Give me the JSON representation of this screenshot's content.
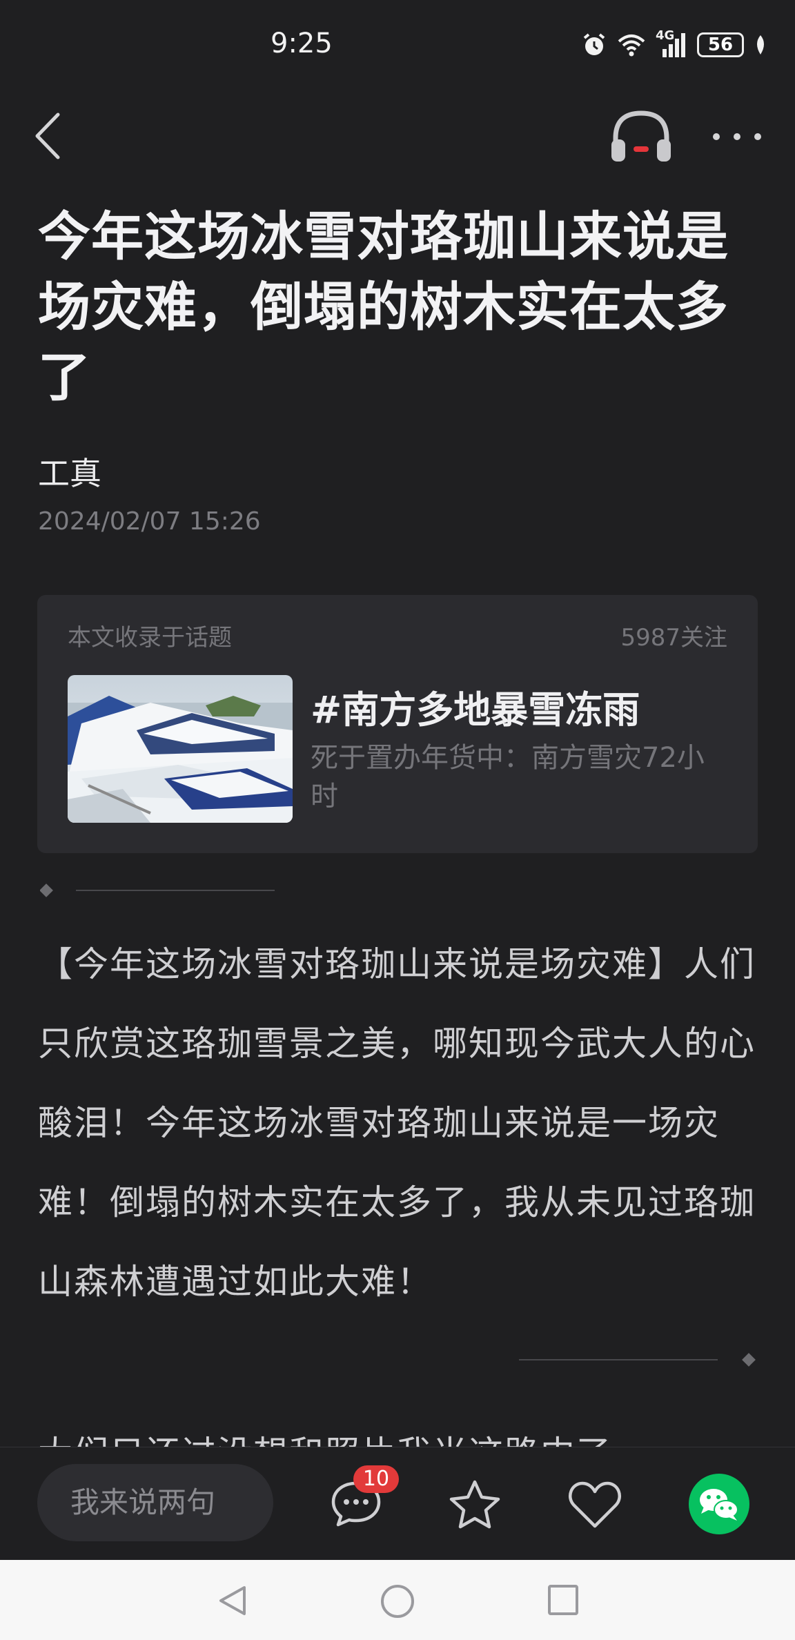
{
  "status_bar": {
    "time": "9:25",
    "network": "4G",
    "battery": "56",
    "icons": [
      "alarm-icon",
      "wifi-icon",
      "signal-icon",
      "battery-icon",
      "leaf-icon"
    ]
  },
  "header": {
    "icons": [
      "back-arrow-icon",
      "headphones-icon",
      "more-dots-icon"
    ]
  },
  "article": {
    "title": "今年这场冰雪对珞珈山来说是场灾难，倒塌的树木实在太多了",
    "author": "工真",
    "date": "2024/02/07 15:26",
    "topic": {
      "hint": "本文收录于话题",
      "follows": "5987关注",
      "name": "#南方多地暴雪冻雨",
      "description": "死于置办年货中：南方雪灾72小时"
    },
    "body": "【今年这场冰雪对珞珈山来说是场灾难】人们只欣赏这珞珈雪景之美，哪知现今武大人的心酸泪！今年这场冰雪对珞珈山来说是一场灾难！倒塌的树木实在太多了，我从未见过珞珈山森林遭遇过如此大难！",
    "next_paragraph_peek": "大们只还过没想和照片我当这路中了"
  },
  "action_bar": {
    "comment_placeholder": "我来说两句",
    "comment_count": "10",
    "icons": [
      "comment-icon",
      "star-icon",
      "heart-icon",
      "wechat-icon"
    ],
    "colors": {
      "badge": "#e23a3a",
      "wechat": "#07c160"
    }
  },
  "nav_bar": {
    "icons": [
      "nav-back-icon",
      "nav-home-icon",
      "nav-recent-icon"
    ]
  }
}
